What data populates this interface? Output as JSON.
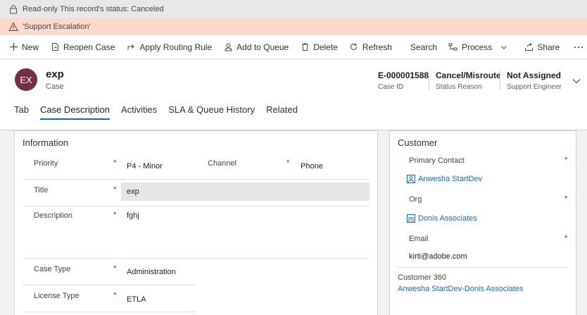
{
  "notifications": {
    "readonly": "Read-only This record's status: Canceled",
    "warning": "'Support Escalation'"
  },
  "commands": {
    "new": "New",
    "reopen": "Reopen Case",
    "routing": "Apply Routing Rule",
    "queue": "Add to Queue",
    "delete": "Delete",
    "refresh": "Refresh",
    "search": "Search",
    "process": "Process",
    "share": "Share",
    "more": "···"
  },
  "record": {
    "initials": "EX",
    "title": "exp",
    "entity": "Case",
    "case_id_value": "E-000001588",
    "case_id_label": "Case ID",
    "status_value": "Cancel/Misroute",
    "status_label": "Status Reason",
    "engineer_value": "Not Assigned",
    "engineer_label": "Support Engineer"
  },
  "tabs": [
    "Tab",
    "Case Description",
    "Activities",
    "SLA & Queue History",
    "Related"
  ],
  "information": {
    "title": "Information",
    "priority_label": "Priority",
    "priority_value": "P4 - Minor",
    "channel_label": "Channel",
    "channel_value": "Phone",
    "title_label": "Title",
    "title_value": "exp",
    "description_label": "Description",
    "description_value": "fghj",
    "case_type_label": "Case Type",
    "case_type_value": "Administration",
    "license_label": "License Type",
    "license_value": "ETLA"
  },
  "customer": {
    "title": "Customer",
    "contact_label": "Primary Contact",
    "contact_value": "Anwesha StartDev",
    "org_label": "Org",
    "org_value": "Donis Associates",
    "email_label": "Email",
    "email_value": "kirti@adobe.com",
    "c360_label": "Customer 360",
    "c360_value": "Anwesha StartDev-Donis Associates"
  },
  "colors": {
    "accent": "#0f6cbd",
    "avatar": "#713043",
    "warning_bg": "#fbd9cc",
    "required": "#c50f1f"
  }
}
